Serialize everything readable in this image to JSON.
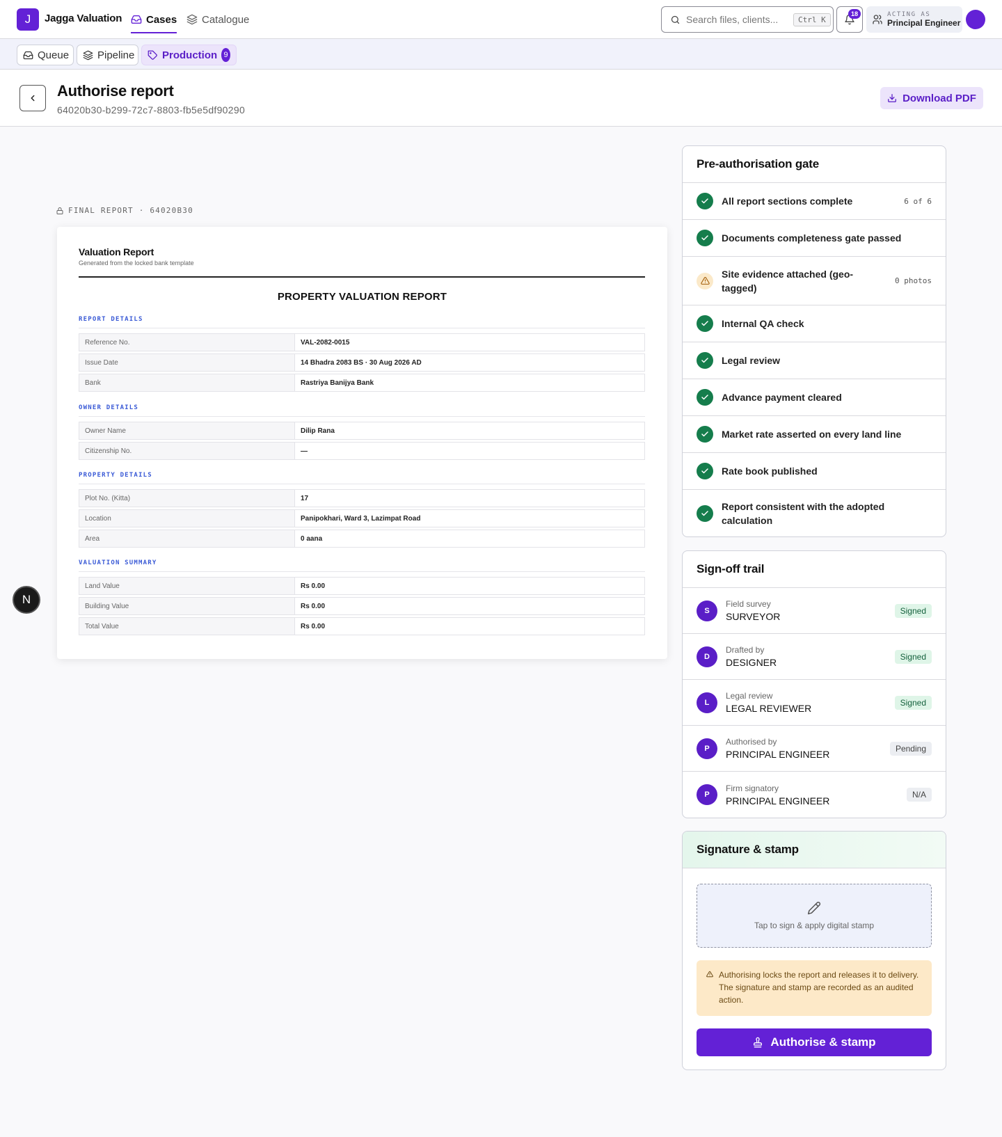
{
  "app": {
    "logo_letter": "J",
    "name": "Jagga Valuation"
  },
  "topnav": [
    {
      "label": "Cases",
      "icon": "inbox-icon",
      "active": true
    },
    {
      "label": "Catalogue",
      "icon": "layers-icon",
      "active": false
    }
  ],
  "search": {
    "placeholder": "Search files, clients...",
    "shortcut": "Ctrl K"
  },
  "notifications": {
    "count": "18"
  },
  "acting_as": {
    "label": "ACTING AS",
    "role": "Principal Engineer"
  },
  "subnav": [
    {
      "label": "Queue",
      "icon": "inbox-icon"
    },
    {
      "label": "Pipeline",
      "icon": "layers-icon"
    },
    {
      "label": "Production",
      "icon": "tag-icon",
      "count": "9",
      "active": true
    }
  ],
  "page": {
    "title": "Authorise report",
    "id": "64020b30-b299-72c7-8803-fb5e5df90290",
    "download_label": "Download PDF"
  },
  "report": {
    "label": "FINAL REPORT · 64020B30",
    "title": "Valuation Report",
    "subtitle": "Generated from the locked bank template",
    "heading": "PROPERTY VALUATION REPORT",
    "sections": [
      {
        "title": "REPORT DETAILS",
        "rows": [
          {
            "key": "Reference No.",
            "value": "VAL-2082-0015"
          },
          {
            "key": "Issue Date",
            "value": "14 Bhadra 2083 BS · 30 Aug 2026 AD"
          },
          {
            "key": "Bank",
            "value": "Rastriya Banijya Bank"
          }
        ]
      },
      {
        "title": "OWNER DETAILS",
        "rows": [
          {
            "key": "Owner Name",
            "value": "Dilip Rana"
          },
          {
            "key": "Citizenship No.",
            "value": "—"
          }
        ]
      },
      {
        "title": "PROPERTY DETAILS",
        "rows": [
          {
            "key": "Plot No. (Kitta)",
            "value": "17"
          },
          {
            "key": "Location",
            "value": "Panipokhari, Ward 3, Lazimpat Road"
          },
          {
            "key": "Area",
            "value": "0 aana"
          }
        ]
      },
      {
        "title": "VALUATION SUMMARY",
        "rows": [
          {
            "key": "Land Value",
            "value": "Rs 0.00"
          },
          {
            "key": "Building Value",
            "value": "Rs 0.00"
          },
          {
            "key": "Total Value",
            "value": "Rs 0.00"
          }
        ]
      }
    ]
  },
  "floating_badge": "N",
  "gate": {
    "title": "Pre-authorisation gate",
    "items": [
      {
        "label": "All report sections complete",
        "status": "ok",
        "meta": "6 of 6"
      },
      {
        "label": "Documents completeness gate passed",
        "status": "ok",
        "meta": ""
      },
      {
        "label": "Site evidence attached (geo-tagged)",
        "status": "warn",
        "meta": "0 photos"
      },
      {
        "label": "Internal QA check",
        "status": "ok",
        "meta": ""
      },
      {
        "label": "Legal review",
        "status": "ok",
        "meta": ""
      },
      {
        "label": "Advance payment cleared",
        "status": "ok",
        "meta": ""
      },
      {
        "label": "Market rate asserted on every land line",
        "status": "ok",
        "meta": ""
      },
      {
        "label": "Rate book published",
        "status": "ok",
        "meta": ""
      },
      {
        "label": "Report consistent with the adopted calculation",
        "status": "ok",
        "meta": ""
      }
    ]
  },
  "signoff": {
    "title": "Sign-off trail",
    "items": [
      {
        "initial": "S",
        "role": "Field survey",
        "name": "SURVEYOR",
        "status": "Signed"
      },
      {
        "initial": "D",
        "role": "Drafted by",
        "name": "DESIGNER",
        "status": "Signed"
      },
      {
        "initial": "L",
        "role": "Legal review",
        "name": "LEGAL REVIEWER",
        "status": "Signed"
      },
      {
        "initial": "P",
        "role": "Authorised by",
        "name": "PRINCIPAL ENGINEER",
        "status": "Pending"
      },
      {
        "initial": "P",
        "role": "Firm signatory",
        "name": "PRINCIPAL ENGINEER",
        "status": "N/A"
      }
    ]
  },
  "stamp": {
    "title": "Signature & stamp",
    "sign_prompt": "Tap to sign & apply digital stamp",
    "notice": "Authorising locks the report and releases it to delivery. The signature and stamp are recorded as an audited action.",
    "button_label": "Authorise & stamp"
  },
  "colors": {
    "accent": "#6321d6",
    "success": "#157d4c",
    "warning_bg": "#fde9c8"
  }
}
